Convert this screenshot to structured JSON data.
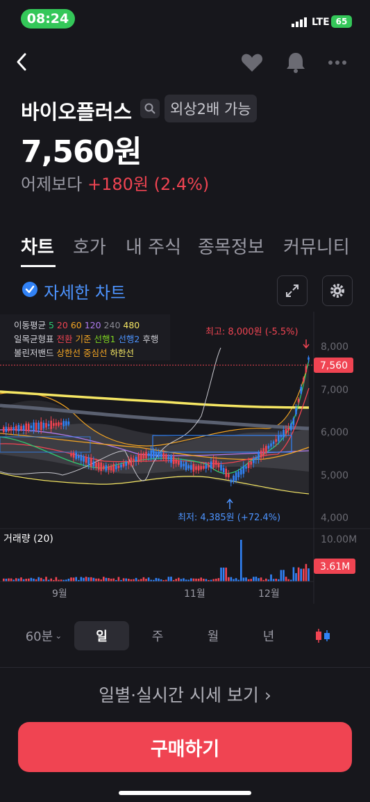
{
  "status_bar": {
    "time": "08:24",
    "network": "LTE",
    "battery": "65"
  },
  "stock": {
    "name": "바이오플러스",
    "badge": "외상2배 가능",
    "price": "7,560원",
    "change_label": "어제보다",
    "change_value": "+180원 (2.4%)"
  },
  "tabs": [
    "차트",
    "호가",
    "내 주식",
    "종목정보",
    "커뮤니티"
  ],
  "detail_chart_label": "자세한 차트",
  "legend": {
    "ma": {
      "label": "이동평균",
      "periods": [
        "5",
        "20",
        "60",
        "120",
        "240",
        "480"
      ],
      "colors": [
        "#2ecc71",
        "#f04452",
        "#f5a623",
        "#b07cf0",
        "#8a8a93",
        "#f5e663"
      ]
    },
    "ichimoku": {
      "label": "일목균형표",
      "items": [
        "전환",
        "기준",
        "선행1",
        "선행2",
        "후행"
      ],
      "colors": [
        "#f04452",
        "#f5a623",
        "#7ed321",
        "#4d94ff",
        "#c9c9d0"
      ]
    },
    "bollinger": {
      "label": "볼린저밴드",
      "items": [
        "상한선",
        "중심선",
        "하한선"
      ],
      "colors": [
        "#f5a623",
        "#f5a623",
        "#f5e663"
      ]
    }
  },
  "chart": {
    "high_label": "최고: 8,000원 (-5.5%)",
    "low_label": "최저: 4,385원 (+72.4%)",
    "current_price_tag": "7,560",
    "y_ticks": [
      "8,000",
      "7,000",
      "6,000",
      "5,000",
      "4,000"
    ],
    "volume_label": "거래량 (20)",
    "volume_max": "10.00M",
    "volume_current": "3.61M",
    "x_ticks": [
      "9월",
      "11월",
      "12월"
    ],
    "colors": {
      "up": "#f04452",
      "down": "#3182f6",
      "ma480": "#f5e663"
    }
  },
  "periods": [
    "60분",
    "일",
    "주",
    "월",
    "년"
  ],
  "active_period": "일",
  "daily_link": "일별·실시간 시세 보기 ›",
  "buy_button": "구매하기"
}
